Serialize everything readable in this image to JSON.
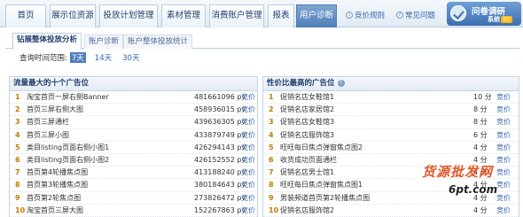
{
  "nav": {
    "tabs": [
      "首页",
      "展示位资源",
      "投放计划管理",
      "素材管理",
      "消费账户管理",
      "报表",
      "用户诊断"
    ],
    "active_index": 6,
    "links": [
      "竞价规则",
      "常见问题"
    ],
    "link_icons": [
      "info-icon",
      "help-icon"
    ],
    "badge": {
      "title": "问卷调研",
      "sub": "系统",
      "tag": "90"
    }
  },
  "subtabs": {
    "items": [
      "钻展整体投放分析",
      "账户诊断",
      "账户整体投放统计"
    ],
    "active_index": 0
  },
  "query": {
    "label": "查询时间范围:",
    "options": [
      "7天",
      "14天",
      "30天"
    ],
    "selected_index": 0
  },
  "left_panel": {
    "title": "流量最大的十个广告位",
    "rows": [
      {
        "idx": "1",
        "name": "淘宝首页一屏右侧Banner",
        "val": "481661096 pv",
        "act": "竞价"
      },
      {
        "idx": "2",
        "name": "首页三屏右侧大图",
        "val": "458936015 pv",
        "act": "竞价"
      },
      {
        "idx": "3",
        "name": "首页三屏通栏",
        "val": "439636305 pv",
        "act": "竞价"
      },
      {
        "idx": "4",
        "name": "首页三屏小图",
        "val": "433879749 pv",
        "act": "竞价"
      },
      {
        "idx": "5",
        "name": "类目listing页面右侧小图1",
        "val": "426294143 pv",
        "act": "竞价"
      },
      {
        "idx": "6",
        "name": "类目listing页面右侧小图2",
        "val": "426152552 pv",
        "act": "竞价"
      },
      {
        "idx": "7",
        "name": "首页第4轮播焦点图",
        "val": "413188240 pv",
        "act": "竞价"
      },
      {
        "idx": "8",
        "name": "首页第3轮播焦点图",
        "val": "380184643 pv",
        "act": "竞价"
      },
      {
        "idx": "9",
        "name": "首页第2轮焦点图",
        "val": "273826472 pv",
        "act": "竞价"
      },
      {
        "idx": "10",
        "name": "淘宝首页三屏大图",
        "val": "152267863 pv",
        "act": "竞价"
      }
    ]
  },
  "right_panel": {
    "title": "性价比最高的广告位",
    "rows": [
      {
        "idx": "1",
        "name": "促销名店女鞋馆1",
        "val": "10 分",
        "act": "竞价"
      },
      {
        "idx": "2",
        "name": "促销名店家居馆2",
        "val": "8 分",
        "act": "竞价"
      },
      {
        "idx": "3",
        "name": "促销名店女鞋馆3",
        "val": "8 分",
        "act": "竞价"
      },
      {
        "idx": "4",
        "name": "促销名店服饰馆3",
        "val": "6 分",
        "act": "竞价"
      },
      {
        "idx": "5",
        "name": "旺旺每日焦点弹窗焦点图2",
        "val": "4 分",
        "act": "竞价"
      },
      {
        "idx": "6",
        "name": "收货成功页面通栏",
        "val": "4 分",
        "act": "竞价"
      },
      {
        "idx": "7",
        "name": "促销名店男士馆1",
        "val": "4 分",
        "act": "竞价"
      },
      {
        "idx": "8",
        "name": "旺旺每日焦点弹窗焦点图1",
        "val": "4 分",
        "act": "竞价"
      },
      {
        "idx": "9",
        "name": "男装频道首页第2轮播焦点图",
        "val": "4 分",
        "act": "竞价"
      },
      {
        "idx": "10",
        "name": "促销名店服饰馆2",
        "val": "4 分",
        "act": "竞价"
      }
    ]
  },
  "watermark": {
    "line1": "货源批发网",
    "line2": "6pt.com"
  }
}
